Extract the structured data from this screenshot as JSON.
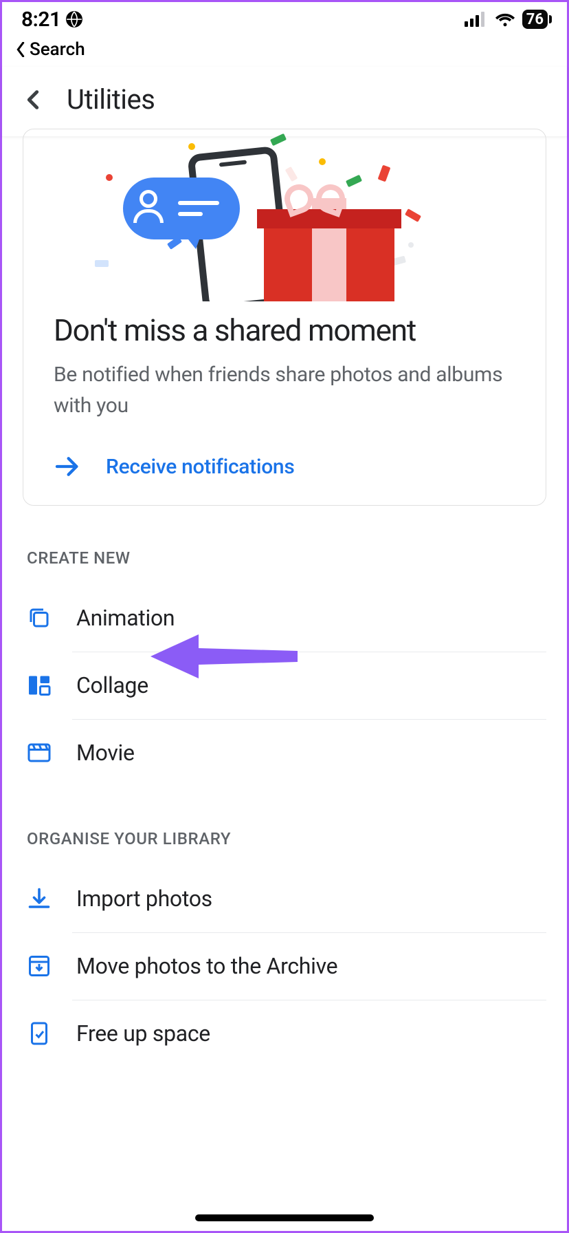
{
  "status": {
    "time": "8:21",
    "battery": "76"
  },
  "breadcrumb": {
    "label": "Search"
  },
  "header": {
    "title": "Utilities"
  },
  "promo": {
    "title": "Don't miss a shared moment",
    "subtitle": "Be notified when friends share photos and albums with you",
    "action_label": "Receive notifications"
  },
  "sections": {
    "create": {
      "heading": "CREATE NEW",
      "items": [
        {
          "label": "Animation"
        },
        {
          "label": "Collage"
        },
        {
          "label": "Movie"
        }
      ]
    },
    "organise": {
      "heading": "ORGANISE YOUR LIBRARY",
      "items": [
        {
          "label": "Import photos"
        },
        {
          "label": "Move photos to the Archive"
        },
        {
          "label": "Free up space"
        }
      ]
    }
  },
  "colors": {
    "accent": "#1a73e8",
    "callout": "#8b5cf6"
  }
}
